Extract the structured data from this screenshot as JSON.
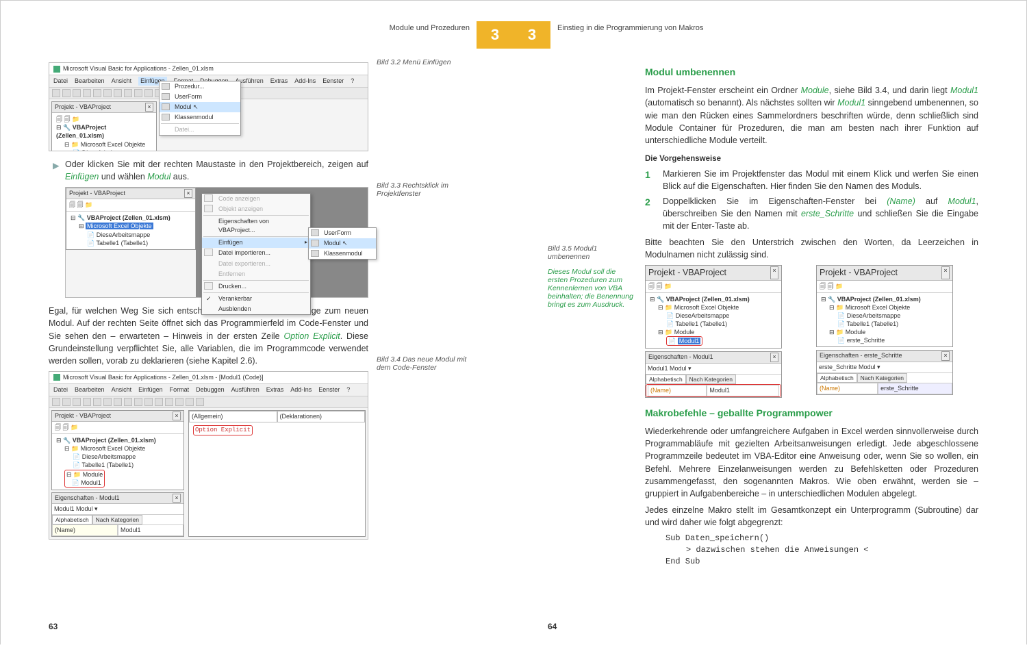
{
  "header": {
    "left_title": "Module und Prozeduren",
    "right_title": "Einstieg in die Programmierung von Makros",
    "chapter": "3"
  },
  "left": {
    "ss32": {
      "caption": "Bild 3.2 Menü Einfügen",
      "win_title": "Microsoft Visual Basic for Applications - Zellen_01.xlsm",
      "menubar": [
        "Datei",
        "Bearbeiten",
        "Ansicht",
        "Einfügen",
        "Format",
        "Debuggen",
        "Ausführen",
        "Extras",
        "Add-Ins",
        "Eenster",
        "?"
      ],
      "menu_open": "Einfügen",
      "proj_title": "Projekt - VBAProject",
      "tree": {
        "root": "VBAProject (Zellen_01.xlsm)",
        "folder": "Microsoft Excel Objekte",
        "items": [
          "DieseArbeitsmappe"
        ]
      },
      "dropdown": [
        {
          "label": "Prozedur...",
          "hl": false
        },
        {
          "label": "UserForm",
          "hl": false
        },
        {
          "label": "Modul",
          "hl": true
        },
        {
          "label": "Klassenmodul",
          "hl": false
        },
        {
          "label": "Datei...",
          "hl": false,
          "disabled": true
        }
      ]
    },
    "p1_a": "Oder klicken Sie mit der rechten Maustaste in den Projektbereich, zeigen auf ",
    "p1_em1": "Einfügen",
    "p1_b": " und wählen ",
    "p1_em2": "Modul",
    "p1_c": " aus.",
    "ss33": {
      "caption": "Bild 3.3 Rechtsklick im Projektfenster",
      "proj_title": "Projekt - VBAProject",
      "tree_root": "VBAProject (Zellen_01.xlsm)",
      "tree_folder_sel": "Microsoft Excel Objekte",
      "tree_items": [
        "DieseArbeitsmappe",
        "Tabelle1 (Tabelle1)"
      ],
      "context": [
        {
          "label": "Code anzeigen",
          "dis": true
        },
        {
          "label": "Objekt anzeigen",
          "dis": true
        },
        {
          "label": "Eigenschaften von VBAProject...",
          "dis": false
        },
        {
          "label": "Einfügen",
          "dis": false,
          "hl": true,
          "sub": true
        },
        {
          "label": "Datei importieren...",
          "dis": false
        },
        {
          "label": "Datei exportieren...",
          "dis": true
        },
        {
          "label": "Entfernen",
          "dis": true
        },
        {
          "label": "Drucken...",
          "dis": false
        },
        {
          "label": "Verankerbar",
          "dis": false,
          "check": true
        },
        {
          "label": "Ausblenden",
          "dis": false
        }
      ],
      "submenu": [
        {
          "label": "UserForm"
        },
        {
          "label": "Modul",
          "hl": true
        },
        {
          "label": "Klassenmodul"
        }
      ]
    },
    "p2_a": "Egal, für welchen Weg Sie sich entscheiden – hier führen alle Wege zum neuen Modul. Auf der rechten Seite öffnet sich das Programmierfeld im Code-Fenster und Sie sehen den – erwarteten – Hinweis in der ersten Zeile ",
    "p2_em": "Option Explicit",
    "p2_b": ". Diese Grundeinstellung verpflichtet Sie, alle Variablen, die im Programmcode verwendet werden sollen, vorab zu deklarieren (siehe Kapitel 2.6).",
    "ss34": {
      "caption": "Bild 3.4 Das neue Modul mit dem Code-Fenster",
      "win_title": "Microsoft Visual Basic for Applications - Zellen_01.xlsm - [Modul1 (Code)]",
      "menubar": [
        "Datei",
        "Bearbeiten",
        "Ansicht",
        "Einfügen",
        "Format",
        "Debuggen",
        "Ausführen",
        "Extras",
        "Add-Ins",
        "Eenster",
        "?"
      ],
      "proj_title": "Projekt - VBAProject",
      "tree_root": "VBAProject (Zellen_01.xlsm)",
      "tree_folder": "Microsoft Excel Objekte",
      "tree_items": [
        "DieseArbeitsmappe",
        "Tabelle1 (Tabelle1)"
      ],
      "tree_modfolder": "Module",
      "tree_mod": "Modul1",
      "props_title": "Eigenschaften - Modul1",
      "props_combo": "Modul1  Modul",
      "props_tabs": [
        "Alphabetisch",
        "Nach Kategorien"
      ],
      "props_name": "(Name)",
      "props_val": "Modul1",
      "code_dd_left": "(Allgemein)",
      "code_dd_right": "(Deklarationen)",
      "code_line": "Option Explicit"
    },
    "pagenum": "63"
  },
  "right": {
    "h1": "Modul umbenennen",
    "p1_a": "Im Projekt-Fenster erscheint ein Ordner ",
    "p1_em1": "Module",
    "p1_b": ", siehe Bild 3.4, und darin liegt ",
    "p1_em2": "Modul1",
    "p1_c": " (automatisch so benannt). Als nächstes sollten wir ",
    "p1_em3": "Modul1",
    "p1_d": " sinngebend umbenennen, so wie man den Rücken eines Sammelordners beschriften würde, denn schließlich sind Module Container für Prozeduren, die man am besten nach ihrer Funktion auf unterschiedliche Module verteilt.",
    "sub1": "Die Vorgehensweise",
    "step1": "Markieren Sie im Projektfenster das Modul mit einem Klick und werfen Sie einen Blick auf die Eigenschaften. Hier finden Sie den Namen des Moduls.",
    "step2_a": "Doppelklicken Sie im Eigenschaften-Fenster bei ",
    "step2_em1": "(Name)",
    "step2_b": " auf ",
    "step2_em2": "Modul1",
    "step2_c": ", überschreiben Sie den Namen mit ",
    "step2_em3": "erste_Schritte",
    "step2_d": " und schließen Sie die Eingabe mit der Enter-Taste ab.",
    "p2": "Bitte beachten Sie den Unterstrich zwischen den Worten, da Leerzeichen in Modulnamen nicht zulässig sind.",
    "ss35": {
      "caption": "Bild 3.5 Modul1 umbenennen",
      "tip": "Dieses Modul soll die ersten Prozeduren zum Kennenlernen von VBA beinhalten; die Benennung bringt es zum Ausdruck.",
      "left": {
        "proj_title": "Projekt - VBAProject",
        "tree_root": "VBAProject (Zellen_01.xlsm)",
        "folder1": "Microsoft Excel Objekte",
        "items": [
          "DieseArbeitsmappe",
          "Tabelle1 (Tabelle1)"
        ],
        "folder2": "Module",
        "mod": "Modul1",
        "props_title": "Eigenschaften - Modul1",
        "props_combo": "Modul1  Modul",
        "tabs": [
          "Alphabetisch",
          "Nach Kategorien"
        ],
        "name": "(Name)",
        "val": "Modul1"
      },
      "right": {
        "proj_title": "Projekt - VBAProject",
        "tree_root": "VBAProject (Zellen_01.xlsm)",
        "folder1": "Microsoft Excel Objekte",
        "items": [
          "DieseArbeitsmappe",
          "Tabelle1 (Tabelle1)"
        ],
        "folder2": "Module",
        "mod": "erste_Schritte",
        "props_title": "Eigenschaften - erste_Schritte",
        "props_combo": "erste_Schritte  Modul",
        "tabs": [
          "Alphabetisch",
          "Nach Kategorien"
        ],
        "name": "(Name)",
        "val": "erste_Schritte"
      }
    },
    "h2": "Makrobefehle – geballte Programmpower",
    "p3": "Wiederkehrende oder umfangreichere Aufgaben in Excel werden sinnvollerweise durch Programmabläufe mit gezielten Arbeitsanweisungen erledigt. Jede abgeschlossene Programmzeile bedeutet im VBA-Editor eine Anweisung oder, wenn Sie so wollen, ein Befehl. Mehrere Einzelanweisungen werden zu Befehlsketten oder Prozeduren zusammengefasst, den sogenannten Makros. Wie oben erwähnt, werden sie – gruppiert in Aufgabenbereiche – in unterschiedlichen Modulen abgelegt.",
    "p4": "Jedes einzelne Makro stellt im Gesamtkonzept ein Unterprogramm (Subroutine) dar und wird daher wie folgt abgegrenzt:",
    "code": {
      "l1": "Sub Daten_speichern()",
      "l2": "> dazwischen stehen die Anweisungen <",
      "l3": "End Sub"
    },
    "pagenum": "64"
  }
}
